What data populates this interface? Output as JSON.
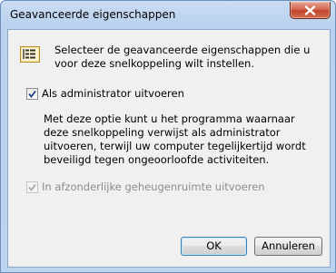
{
  "window": {
    "title": "Geavanceerde eigenschappen",
    "close_icon": "close-icon"
  },
  "intro": {
    "icon": "properties-icon",
    "text": "Selecteer de geavanceerde eigenschappen die u voor deze snelkoppeling wilt instellen."
  },
  "options": {
    "run_as_admin": {
      "label": "Als administrator uitvoeren",
      "checked": true,
      "enabled": true
    },
    "description": "Met deze optie kunt u het programma waarnaar deze snelkoppeling verwijst als administrator uitvoeren, terwijl uw computer tegelijkertijd wordt beveiligd tegen ongeoorloofde activiteiten.",
    "separate_memory": {
      "label": "In afzonderlijke geheugenruimte uitvoeren",
      "checked": true,
      "enabled": false
    }
  },
  "buttons": {
    "ok_label": "OK",
    "cancel_label": "Annuleren"
  }
}
